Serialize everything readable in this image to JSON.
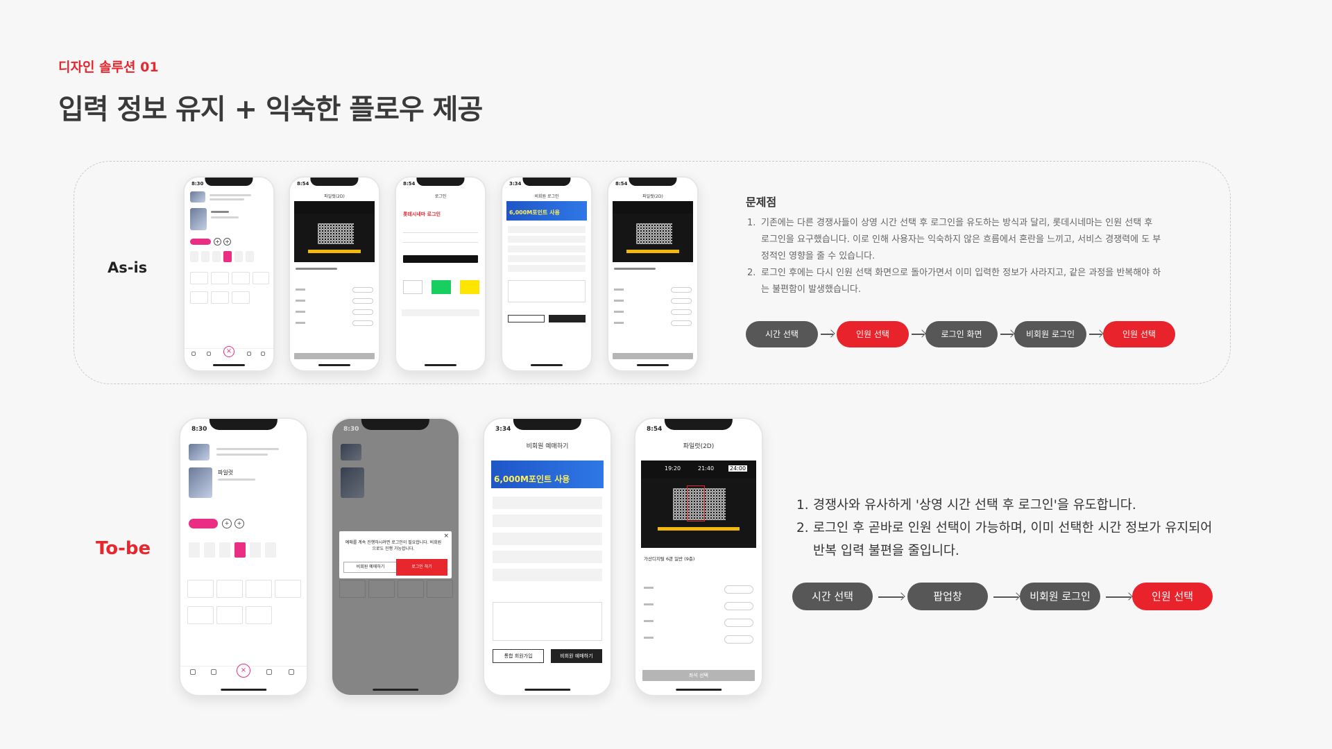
{
  "header": {
    "eyebrow": "디자인 솔루션 01",
    "title": "입력 정보 유지 + 익숙한 플로우 제공"
  },
  "asis": {
    "label": "As-is",
    "problem_title": "문제점",
    "problems": [
      {
        "num": "1.",
        "text": "기존에는 다른 경쟁사들이 상영 시간 선택 후 로그인을 유도하는 방식과 달리, 롯데시네마는 인원 선택 후 로그인을 요구했습니다. 이로 인해 사용자는 익숙하지 않은 흐름에서 혼란을 느끼고, 서비스 경쟁력에 도 부정적인 영향을 줄 수 있습니다."
      },
      {
        "num": "2.",
        "text": "로그인 후에는 다시 인원 선택 화면으로 돌아가면서 이미 입력한 정보가 사라지고, 같은 과정을 반복해야 하는 불편함이 발생했습니다."
      }
    ],
    "flow": [
      {
        "label": "시간 선택",
        "tone": "gray"
      },
      {
        "label": "인원 선택",
        "tone": "red"
      },
      {
        "label": "로그인 화면",
        "tone": "gray"
      },
      {
        "label": "비회원 로그인",
        "tone": "gray"
      },
      {
        "label": "인원 선택",
        "tone": "red"
      }
    ],
    "phones": {
      "p1": {
        "time": "8:30"
      },
      "p2": {
        "time": "8:54",
        "title": "파일럿(2D)"
      },
      "p3": {
        "time": "8:54",
        "title": "로그인",
        "brand": "롯데시네마 로그인"
      },
      "p4": {
        "time": "3:34",
        "title": "비회원 로그인",
        "banner": "6,000M포인트 사용"
      },
      "p5": {
        "time": "8:54",
        "title": "파일럿(2D)"
      }
    }
  },
  "tobe": {
    "label": "To-be",
    "points": [
      {
        "num": "1.",
        "text": "경쟁사와 유사하게 '상영 시간 선택 후 로그인'을 유도합니다."
      },
      {
        "num": "2.",
        "text": "로그인 후 곧바로 인원 선택이 가능하며, 이미 선택한 시간 정보가 유지되어 반복 입력 불편을 줄입니다."
      }
    ],
    "flow": [
      {
        "label": "시간 선택",
        "tone": "gray"
      },
      {
        "label": "팝업창",
        "tone": "gray"
      },
      {
        "label": "비회원 로그인",
        "tone": "gray"
      },
      {
        "label": "인원 선택",
        "tone": "red"
      }
    ],
    "phones": {
      "p1": {
        "time": "8:30",
        "movie": "파일럿"
      },
      "p2": {
        "time": "8:30",
        "popup_msg": "예매를 계속 진행하시려면 로그인이 필요합니다. 비회원으로도 진행 가능합니다.",
        "popup_btn1": "비회원 예매하기",
        "popup_btn2": "로그인 하기"
      },
      "p3": {
        "time": "3:34",
        "title": "비회원 예매하기",
        "banner": "6,000M포인트 사용",
        "btn1": "통합 회원가입",
        "btn2": "비회원 예매하기"
      },
      "p4": {
        "time": "8:54",
        "title": "파일럿(2D)",
        "times": [
          "19:20",
          "21:40",
          "24:00"
        ],
        "section": "가산디지털 6관 일반 (9층)",
        "submit": "좌석 선택"
      }
    }
  },
  "colors": {
    "accent": "#e8262d",
    "chip_gray": "#575757",
    "pink": "#ea2e84"
  }
}
